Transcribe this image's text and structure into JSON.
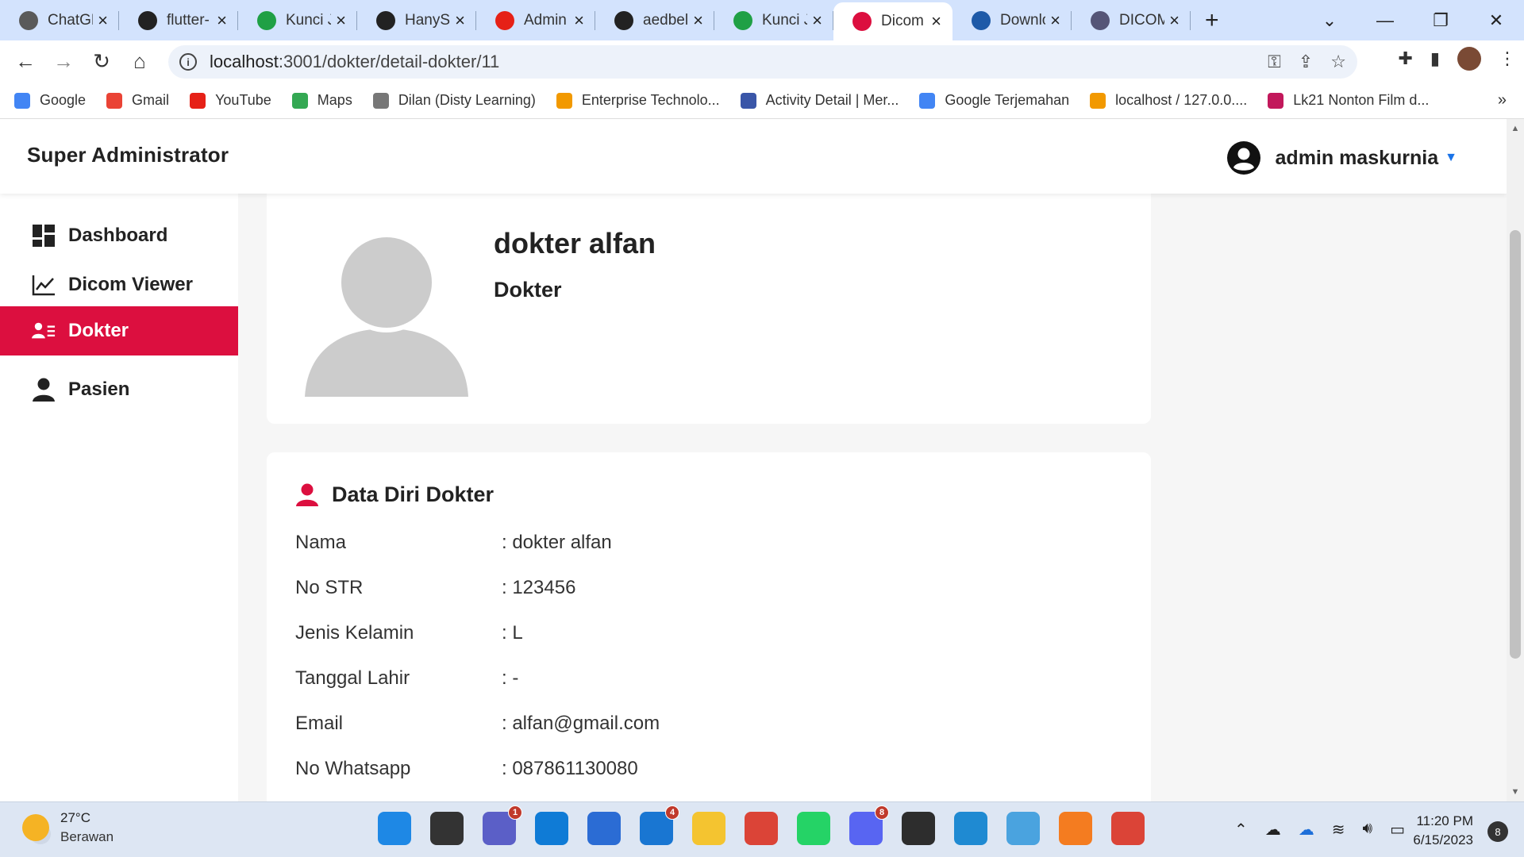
{
  "browser": {
    "tabs": [
      {
        "title": "ChatGPT",
        "icon": "openai-icon",
        "color": "#5a5a5a"
      },
      {
        "title": "flutter-",
        "icon": "github-icon",
        "color": "#222222"
      },
      {
        "title": "Kunci Jawaban",
        "icon": "copyright-icon",
        "color": "#1fa045"
      },
      {
        "title": "HanySa",
        "icon": "github-icon",
        "color": "#222222"
      },
      {
        "title": "Admin",
        "icon": "youtube-icon",
        "color": "#e62117"
      },
      {
        "title": "aedbel",
        "icon": "github-icon",
        "color": "#222222"
      },
      {
        "title": "Kunci Jawaban",
        "icon": "copyright-icon",
        "color": "#1fa045"
      },
      {
        "title": "Dicom",
        "icon": "dicom-icon",
        "color": "#dc0f3f"
      },
      {
        "title": "Download",
        "icon": "download-icon",
        "color": "#1e5aa8"
      },
      {
        "title": "DICOM",
        "icon": "dicom-library-icon",
        "color": "#555577"
      }
    ],
    "active_tab": 7,
    "url_host": "localhost",
    "url_path": ":3001/dokter/detail-dokter/11",
    "bookmarks": [
      {
        "label": "Google",
        "icon": "google-icon",
        "color": "#4285f4"
      },
      {
        "label": "Gmail",
        "icon": "gmail-icon",
        "color": "#ea4335"
      },
      {
        "label": "YouTube",
        "icon": "youtube-icon",
        "color": "#e62117"
      },
      {
        "label": "Maps",
        "icon": "maps-icon",
        "color": "#34a853"
      },
      {
        "label": "Dilan (Disty Learning)",
        "icon": "dilan-icon",
        "color": "#777777"
      },
      {
        "label": "Enterprise Technolo...",
        "icon": "enterprise-icon",
        "color": "#f29900"
      },
      {
        "label": "Activity Detail | Mer...",
        "icon": "activity-icon",
        "color": "#3a56a8"
      },
      {
        "label": "Google Terjemahan",
        "icon": "translate-icon",
        "color": "#4285f4"
      },
      {
        "label": "localhost / 127.0.0....",
        "icon": "phpmyadmin-icon",
        "color": "#f29900"
      },
      {
        "label": "Lk21 Nonton Film d...",
        "icon": "lk21-icon",
        "color": "#c2185b"
      }
    ],
    "bookmarks_more": "»"
  },
  "app": {
    "brand": "Super Administrator",
    "user_name": "admin maskurnia",
    "accent": "#dc0f3f",
    "sidebar": [
      {
        "label": "Dashboard",
        "icon": "dashboard-icon",
        "active": false
      },
      {
        "label": "Dicom Viewer",
        "icon": "chart-line-icon",
        "active": false
      },
      {
        "label": "Dokter",
        "icon": "user-list-icon",
        "active": true
      },
      {
        "label": "Pasien",
        "icon": "user-icon",
        "active": false
      }
    ]
  },
  "profile": {
    "name": "dokter alfan",
    "role": "Dokter"
  },
  "details": {
    "title": "Data Diri Dokter",
    "rows": [
      {
        "label": "Nama",
        "value": ": dokter alfan"
      },
      {
        "label": "No STR",
        "value": ": 123456"
      },
      {
        "label": "Jenis Kelamin",
        "value": ": L"
      },
      {
        "label": "Tanggal Lahir",
        "value": ": -"
      },
      {
        "label": "Email",
        "value": ": alfan@gmail.com"
      },
      {
        "label": "No Whatsapp",
        "value": ": 087861130080"
      }
    ]
  },
  "taskbar": {
    "temperature": "27°C",
    "weather": "Berawan",
    "time": "11:20 PM",
    "date": "6/15/2023",
    "notifications": "8",
    "apps": [
      {
        "name": "windows-start-icon",
        "color": "#1e88e5",
        "badge": ""
      },
      {
        "name": "task-view-icon",
        "color": "#333333",
        "badge": ""
      },
      {
        "name": "teams-icon",
        "color": "#5b5fc7",
        "badge": "1"
      },
      {
        "name": "edge-icon",
        "color": "#0f7bd6",
        "badge": ""
      },
      {
        "name": "store-icon",
        "color": "#2b6cd4",
        "badge": ""
      },
      {
        "name": "mail-icon",
        "color": "#1976d2",
        "badge": "4"
      },
      {
        "name": "file-explorer-icon",
        "color": "#f4c430",
        "badge": ""
      },
      {
        "name": "chrome-icon",
        "color": "#db4437",
        "badge": ""
      },
      {
        "name": "whatsapp-icon",
        "color": "#25d366",
        "badge": ""
      },
      {
        "name": "discord-icon",
        "color": "#5865f2",
        "badge": "8"
      },
      {
        "name": "terminal-icon",
        "color": "#2d2d2d",
        "badge": ""
      },
      {
        "name": "vscode-icon",
        "color": "#1f8ad2",
        "badge": ""
      },
      {
        "name": "control-panel-icon",
        "color": "#4aa3df",
        "badge": ""
      },
      {
        "name": "xampp-icon",
        "color": "#f47c20",
        "badge": ""
      },
      {
        "name": "chrome-profile-icon",
        "color": "#db4437",
        "badge": ""
      }
    ]
  }
}
